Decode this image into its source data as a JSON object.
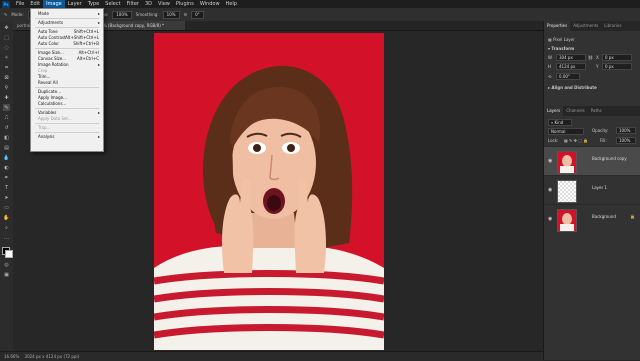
{
  "menubar": {
    "logo": "Ps",
    "items": [
      "File",
      "Edit",
      "Image",
      "Layer",
      "Type",
      "Select",
      "Filter",
      "3D",
      "View",
      "Plugins",
      "Window",
      "Help"
    ],
    "active_index": 2
  },
  "options_bar": {
    "mode_label": "Mode:",
    "mode_value": "Normal",
    "opacity_label": "Opacity:",
    "opacity_value": "100%",
    "flow_label": "Flow:",
    "flow_value": "100%",
    "smoothing_label": "Smoothing:",
    "smoothing_value": "10%",
    "angle_value": "0°"
  },
  "document_tabs": [
    {
      "label": "portrait...",
      "active": false
    },
    {
      "label": "...% (Background copy, RGB/8) *",
      "active": true
    }
  ],
  "image_menu": {
    "items": [
      {
        "label": "Mode",
        "shortcut": "",
        "submenu": true,
        "disabled": false
      },
      {
        "sep": true
      },
      {
        "label": "Adjustments",
        "shortcut": "",
        "submenu": true,
        "disabled": false
      },
      {
        "sep": true
      },
      {
        "label": "Auto Tone",
        "shortcut": "Shift+Ctrl+L",
        "submenu": false,
        "disabled": false
      },
      {
        "label": "Auto Contrast",
        "shortcut": "Alt+Shift+Ctrl+L",
        "submenu": false,
        "disabled": false
      },
      {
        "label": "Auto Color",
        "shortcut": "Shift+Ctrl+B",
        "submenu": false,
        "disabled": false
      },
      {
        "sep": true
      },
      {
        "label": "Image Size...",
        "shortcut": "Alt+Ctrl+I",
        "submenu": false,
        "disabled": false
      },
      {
        "label": "Canvas Size...",
        "shortcut": "Alt+Ctrl+C",
        "submenu": false,
        "disabled": false
      },
      {
        "label": "Image Rotation",
        "shortcut": "",
        "submenu": true,
        "disabled": false
      },
      {
        "label": "Crop",
        "shortcut": "",
        "submenu": false,
        "disabled": true
      },
      {
        "label": "Trim...",
        "shortcut": "",
        "submenu": false,
        "disabled": false
      },
      {
        "label": "Reveal All",
        "shortcut": "",
        "submenu": false,
        "disabled": false
      },
      {
        "sep": true
      },
      {
        "label": "Duplicate...",
        "shortcut": "",
        "submenu": false,
        "disabled": false
      },
      {
        "label": "Apply Image...",
        "shortcut": "",
        "submenu": false,
        "disabled": false
      },
      {
        "label": "Calculations...",
        "shortcut": "",
        "submenu": false,
        "disabled": false
      },
      {
        "sep": true
      },
      {
        "label": "Variables",
        "shortcut": "",
        "submenu": true,
        "disabled": false
      },
      {
        "label": "Apply Data Set...",
        "shortcut": "",
        "submenu": false,
        "disabled": true
      },
      {
        "sep": true
      },
      {
        "label": "Trap...",
        "shortcut": "",
        "submenu": false,
        "disabled": true
      },
      {
        "sep": true
      },
      {
        "label": "Analysis",
        "shortcut": "",
        "submenu": true,
        "disabled": false
      }
    ]
  },
  "properties_panel": {
    "tabs": [
      "Properties",
      "Adjustments",
      "Libraries"
    ],
    "layer_type": "Pixel Layer",
    "transform_title": "Transform",
    "w_value": "304 px",
    "h_value": "4124 px",
    "x_value": "0 px",
    "y_value": "0 px",
    "angle_value": "0.00°",
    "align_title": "Align and Distribute"
  },
  "layers_panel": {
    "tabs": [
      "Layers",
      "Channels",
      "Paths"
    ],
    "kind_label": "Kind",
    "blend_mode": "Normal",
    "opacity_label": "Opacity:",
    "opacity_value": "100%",
    "lock_label": "Lock:",
    "fill_label": "Fill:",
    "fill_value": "100%",
    "layers": [
      {
        "name": "Background copy",
        "selected": true,
        "visible": true
      },
      {
        "name": "Layer 1",
        "selected": false,
        "visible": true
      },
      {
        "name": "Background",
        "selected": false,
        "visible": true
      }
    ]
  },
  "status_bar": {
    "zoom": "16.66%",
    "info": "3024 px x 4124 px (72 ppi)"
  }
}
